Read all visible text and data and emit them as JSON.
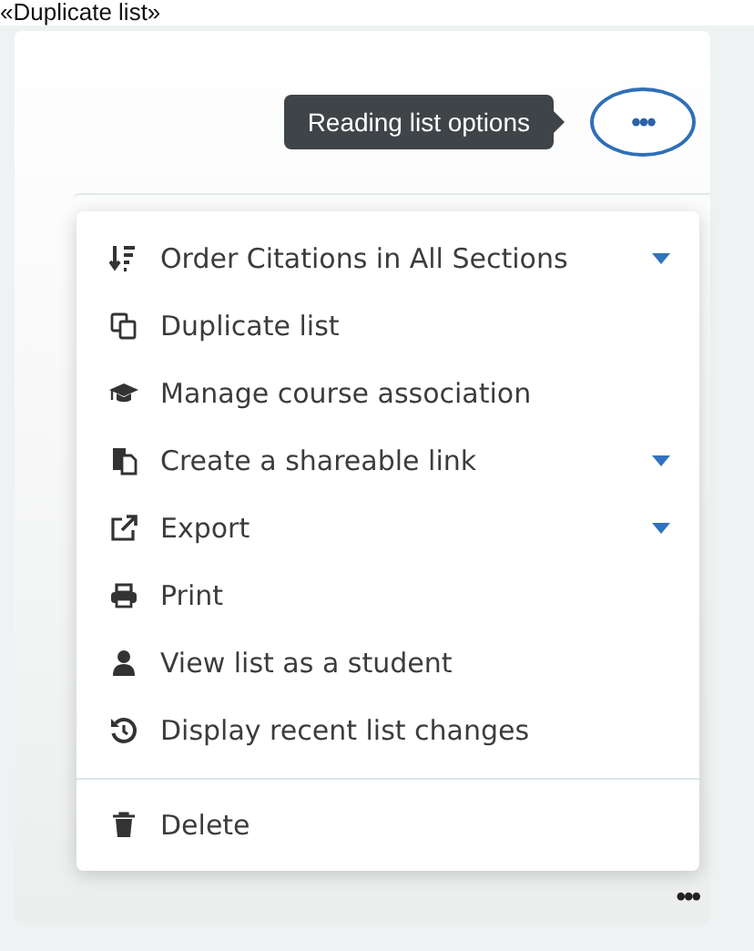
{
  "caption": "«Duplicate list»",
  "tooltip": "Reading list options",
  "options_button": {
    "label": "•••",
    "expanded": true
  },
  "menu": {
    "items": [
      {
        "label": "Order Citations in All Sections",
        "submenu": true
      },
      {
        "label": "Duplicate list",
        "submenu": false
      },
      {
        "label": "Manage course association",
        "submenu": false
      },
      {
        "label": "Create a shareable link",
        "submenu": true
      },
      {
        "label": "Export",
        "submenu": true
      },
      {
        "label": "Print",
        "submenu": false
      },
      {
        "label": "View list as a student",
        "submenu": false
      },
      {
        "label": "Display recent list changes",
        "submenu": false
      }
    ],
    "footer_items": [
      {
        "label": "Delete"
      }
    ]
  },
  "more_button": {
    "label": "•••"
  }
}
